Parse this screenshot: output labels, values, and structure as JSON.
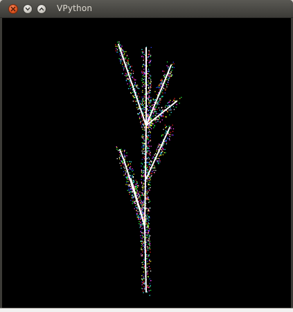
{
  "window": {
    "title": "VPython",
    "buttons": {
      "close": "close-icon",
      "minimize": "minimize-icon",
      "maximize": "maximize-icon"
    }
  },
  "scene": {
    "background": "#000000",
    "branch_color": "#ffffff",
    "particle_colors": [
      "#ff2020",
      "#20ff40",
      "#3040ff",
      "#ffff30",
      "#ff40ff",
      "#40ffff",
      "#ffffff"
    ]
  }
}
